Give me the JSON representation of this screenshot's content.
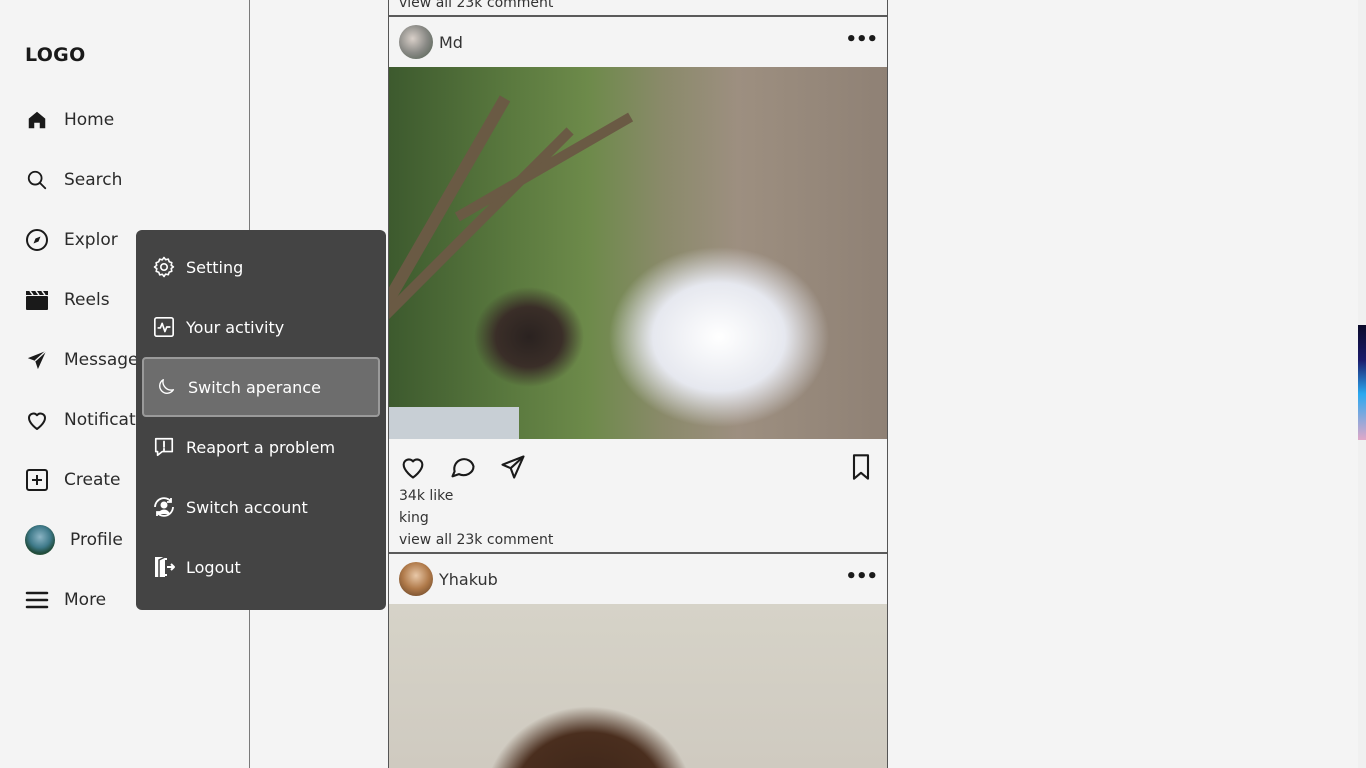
{
  "sidebar": {
    "logo": "LOGO",
    "items": [
      {
        "label": "Home",
        "icon": "home-icon"
      },
      {
        "label": "Search",
        "icon": "search-icon"
      },
      {
        "label": "Explor",
        "icon": "compass-icon"
      },
      {
        "label": "Reels",
        "icon": "clapperboard-icon"
      },
      {
        "label": "Message",
        "icon": "send-icon"
      },
      {
        "label": "Notification",
        "icon": "heart-icon"
      },
      {
        "label": "Create",
        "icon": "plus-square-icon"
      },
      {
        "label": "Profile",
        "icon": "avatar"
      },
      {
        "label": "More",
        "icon": "hamburger-icon"
      }
    ]
  },
  "more_menu": {
    "items": [
      {
        "label": "Setting",
        "icon": "gear-icon"
      },
      {
        "label": "Your activity",
        "icon": "activity-icon"
      },
      {
        "label": "Switch aperance",
        "icon": "moon-icon",
        "active": true
      },
      {
        "label": "Reaport a problem",
        "icon": "report-icon"
      },
      {
        "label": "Switch account",
        "icon": "switch-account-icon"
      },
      {
        "label": "Logout",
        "icon": "logout-icon"
      }
    ]
  },
  "feed": {
    "previous_post": {
      "comments_link": "view all 23k comment"
    },
    "posts": [
      {
        "user": "Md",
        "likes": "34k like",
        "caption": "king",
        "comments_link": "view all 23k comment"
      },
      {
        "user": "Yhakub"
      }
    ]
  },
  "colors": {
    "background": "#f4f4f4",
    "menu_bg": "#444444",
    "menu_active": "#6d6d6d",
    "text": "#1a1a1a"
  }
}
